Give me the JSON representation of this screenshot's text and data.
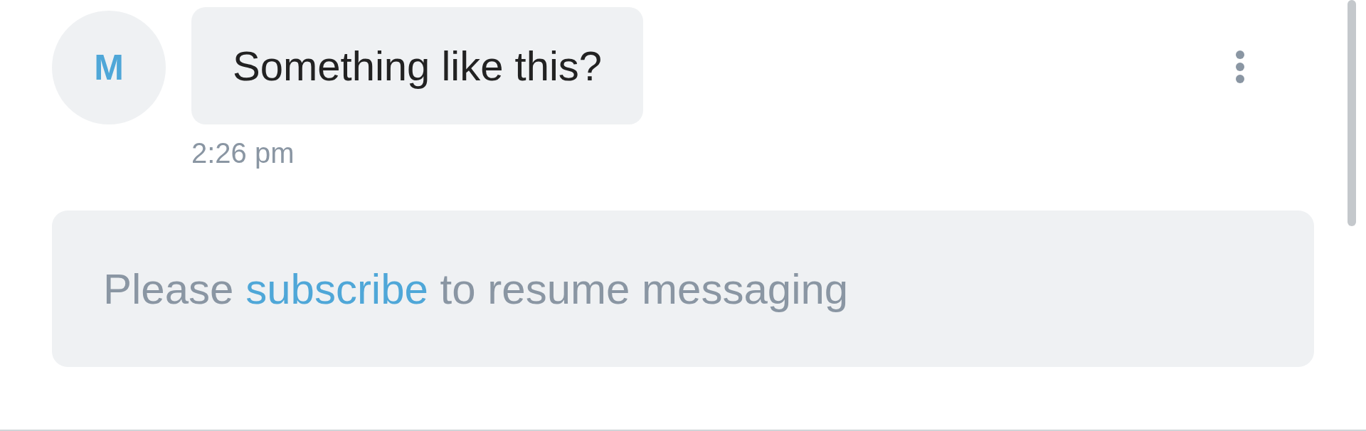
{
  "message": {
    "avatar_initial": "M",
    "text": "Something like this?",
    "time": "2:26 pm"
  },
  "notice": {
    "before": "Please ",
    "link": "subscribe",
    "after": " to resume messaging"
  }
}
